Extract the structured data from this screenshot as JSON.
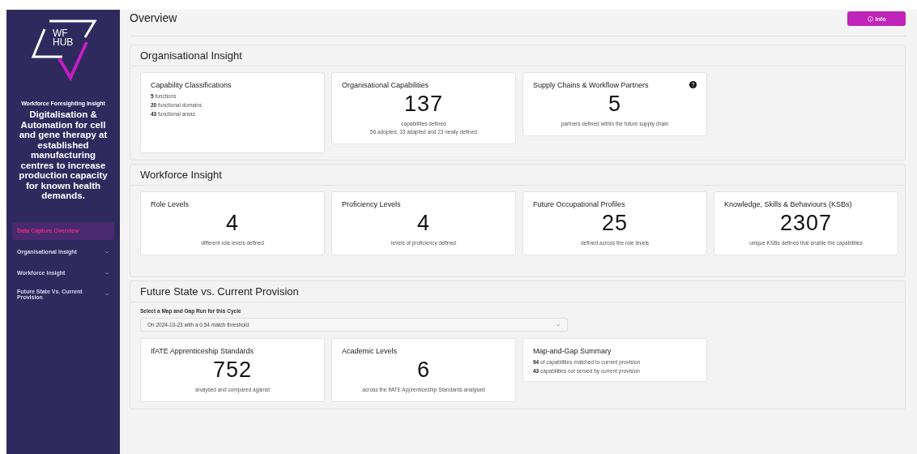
{
  "sidebar": {
    "logo": {
      "line1": "WF",
      "line2": "HUB"
    },
    "eyebrow": "Workforce Foresighting Insight",
    "title": "Digitalisation & Automation for cell and gene therapy at established manufacturing centres to increase production capacity for known health demands.",
    "items": [
      {
        "label": "Data Capture Overview",
        "selected": true,
        "expandable": false
      },
      {
        "label": "Organisational Insight",
        "selected": false,
        "expandable": true
      },
      {
        "label": "Workforce Insight",
        "selected": false,
        "expandable": true
      },
      {
        "label": "Future State Vs. Current Provision",
        "selected": false,
        "expandable": true
      }
    ]
  },
  "header": {
    "title": "Overview",
    "info_button": "Info"
  },
  "sections": [
    {
      "title": "Organisational Insight",
      "cards": [
        {
          "kind": "list",
          "title": "Capability Classifications",
          "lines": [
            "**5** functions",
            "**20** functional domains",
            "**43** functional areas"
          ]
        },
        {
          "kind": "stat",
          "title": "Organisational Capabilities",
          "value": "137",
          "captions": [
            "capabilities defined",
            "56 adopted, 33 adapted and 23 newly defined"
          ],
          "help": false
        },
        {
          "kind": "stat",
          "title": "Supply Chains & Workflow Partners",
          "value": "5",
          "captions": [
            "partners defined within the future supply chain"
          ],
          "help": true
        }
      ]
    },
    {
      "title": "Workforce Insight",
      "cards": [
        {
          "kind": "stat",
          "title": "Role Levels",
          "value": "4",
          "captions": [
            "different role levels defined"
          ],
          "help": false
        },
        {
          "kind": "stat",
          "title": "Proficiency Levels",
          "value": "4",
          "captions": [
            "levels of proficiency defined"
          ],
          "help": false
        },
        {
          "kind": "stat",
          "title": "Future Occupational Profiles",
          "value": "25",
          "captions": [
            "defined across the role levels"
          ],
          "help": false
        },
        {
          "kind": "stat",
          "title": "Knowledge, Skills & Behaviours (KSBs)",
          "value": "2307",
          "captions": [
            "unique KSBs defined that enable the capabilities"
          ],
          "help": false
        }
      ]
    },
    {
      "title": "Future State vs. Current Provision",
      "select": {
        "label": "Select a Map and Gap Run for this Cycle",
        "value": "On 2024-10-23 with a 0.54 match threshold"
      },
      "cards": [
        {
          "kind": "stat",
          "title": "IfATE Apprenticeship Standards",
          "value": "752",
          "captions": [
            "analysed and compared against"
          ],
          "help": false
        },
        {
          "kind": "stat",
          "title": "Academic Levels",
          "value": "6",
          "captions": [
            "across the IfATE Apprenticeship Standards analysed"
          ],
          "help": false
        },
        {
          "kind": "list",
          "title": "Map-and-Gap Summary",
          "lines": [
            "**94** of capabilities matched to current provision",
            "**43** capabilities not served by current provision"
          ]
        }
      ]
    }
  ]
}
